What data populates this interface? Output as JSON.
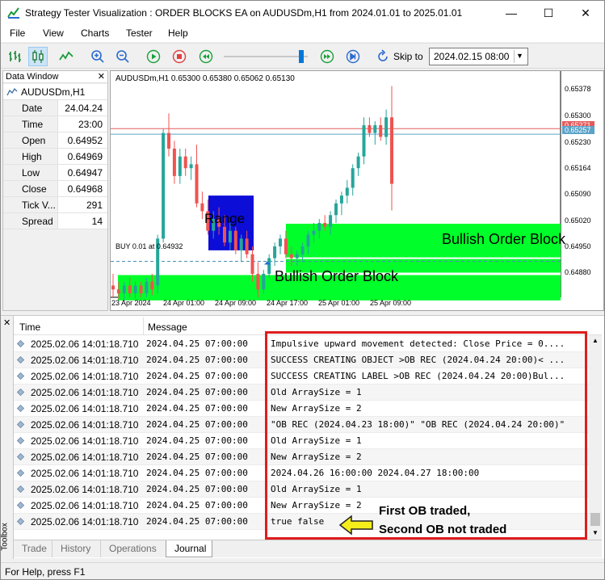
{
  "window": {
    "title": "Strategy Tester Visualization : ORDER BLOCKS EA on AUDUSDm,H1 from 2024.01.01 to 2025.01.01",
    "minimize": "—",
    "maximize": "☐",
    "close": "✕"
  },
  "menu": [
    "File",
    "View",
    "Charts",
    "Tester",
    "Help"
  ],
  "toolbar": {
    "skip_to_label": "Skip to",
    "skip_to_value": "2024.02.15 08:00",
    "slider_position_pct": 90
  },
  "data_window": {
    "title": "Data Window",
    "close": "✕",
    "symbol": "AUDUSDm,H1",
    "rows": [
      {
        "label": "Date",
        "value": "24.04.24"
      },
      {
        "label": "Time",
        "value": "23:00"
      },
      {
        "label": "Open",
        "value": "0.64952"
      },
      {
        "label": "High",
        "value": "0.64969"
      },
      {
        "label": "Low",
        "value": "0.64947"
      },
      {
        "label": "Close",
        "value": "0.64968"
      },
      {
        "label": "Tick V...",
        "value": "291"
      },
      {
        "label": "Spread",
        "value": "14"
      }
    ]
  },
  "chart": {
    "info": "AUDUSDm,H1  0.65300 0.65380 0.65062 0.65130",
    "buy_label": "BUY 0.01 at 0.64932",
    "range_label": "Range",
    "ob_label_1": "Bullish Order Block",
    "ob_label_2": "Bullish Order Block",
    "y_ticks": [
      "0.65378",
      "0.65300",
      "0.65230",
      "0.65164",
      "0.65090",
      "0.65020",
      "0.64950",
      "0.64880"
    ],
    "x_ticks": [
      "23 Apr 2024",
      "24 Apr 01:00",
      "24 Apr 09:00",
      "24 Apr 17:00",
      "25 Apr 01:00",
      "25 Apr 09:00"
    ],
    "price_tags": [
      {
        "value": "0.65271",
        "color": "#e35b5b"
      },
      {
        "value": "0.65257",
        "color": "#5ba3c7"
      }
    ],
    "colors": {
      "bull": "#26a69a",
      "bear": "#ef5350",
      "order_block": "#00ff2a",
      "range": "#0d0dd8"
    }
  },
  "chart_data": {
    "type": "candlestick",
    "symbol": "AUDUSDm",
    "timeframe": "H1",
    "ylim": [
      0.6484,
      0.6541
    ],
    "candles": [
      {
        "o": 0.6487,
        "h": 0.649,
        "l": 0.6484,
        "c": 0.6486
      },
      {
        "o": 0.6486,
        "h": 0.6488,
        "l": 0.64835,
        "c": 0.6485
      },
      {
        "o": 0.6485,
        "h": 0.6488,
        "l": 0.6483,
        "c": 0.6487
      },
      {
        "o": 0.6487,
        "h": 0.6489,
        "l": 0.6484,
        "c": 0.6485
      },
      {
        "o": 0.6485,
        "h": 0.6488,
        "l": 0.64835,
        "c": 0.6487
      },
      {
        "o": 0.6487,
        "h": 0.6488,
        "l": 0.6484,
        "c": 0.6485
      },
      {
        "o": 0.6485,
        "h": 0.6489,
        "l": 0.6484,
        "c": 0.6488
      },
      {
        "o": 0.6488,
        "h": 0.649,
        "l": 0.64845,
        "c": 0.6486
      },
      {
        "o": 0.6487,
        "h": 0.65,
        "l": 0.6485,
        "c": 0.6499
      },
      {
        "o": 0.6499,
        "h": 0.6527,
        "l": 0.6498,
        "c": 0.6526
      },
      {
        "o": 0.6526,
        "h": 0.6531,
        "l": 0.652,
        "c": 0.6522
      },
      {
        "o": 0.6522,
        "h": 0.6524,
        "l": 0.6513,
        "c": 0.6515
      },
      {
        "o": 0.6515,
        "h": 0.6522,
        "l": 0.6513,
        "c": 0.652
      },
      {
        "o": 0.652,
        "h": 0.6522,
        "l": 0.6515,
        "c": 0.6517
      },
      {
        "o": 0.6517,
        "h": 0.652,
        "l": 0.6514,
        "c": 0.6518
      },
      {
        "o": 0.6518,
        "h": 0.6523,
        "l": 0.6507,
        "c": 0.6508
      },
      {
        "o": 0.6508,
        "h": 0.6511,
        "l": 0.6504,
        "c": 0.6506
      },
      {
        "o": 0.6506,
        "h": 0.6509,
        "l": 0.65,
        "c": 0.6501
      },
      {
        "o": 0.6501,
        "h": 0.6506,
        "l": 0.6499,
        "c": 0.6504
      },
      {
        "o": 0.6504,
        "h": 0.6507,
        "l": 0.65,
        "c": 0.6502
      },
      {
        "o": 0.6502,
        "h": 0.6505,
        "l": 0.6497,
        "c": 0.6498
      },
      {
        "o": 0.6498,
        "h": 0.6503,
        "l": 0.6496,
        "c": 0.6501
      },
      {
        "o": 0.6501,
        "h": 0.6502,
        "l": 0.6495,
        "c": 0.6496
      },
      {
        "o": 0.6496,
        "h": 0.65,
        "l": 0.6493,
        "c": 0.6499
      },
      {
        "o": 0.6499,
        "h": 0.6501,
        "l": 0.6494,
        "c": 0.6495
      },
      {
        "o": 0.6495,
        "h": 0.6497,
        "l": 0.6488,
        "c": 0.649
      },
      {
        "o": 0.649,
        "h": 0.6493,
        "l": 0.6484,
        "c": 0.6486
      },
      {
        "o": 0.6486,
        "h": 0.6491,
        "l": 0.6485,
        "c": 0.649
      },
      {
        "o": 0.649,
        "h": 0.6495,
        "l": 0.6489,
        "c": 0.6494
      },
      {
        "o": 0.6494,
        "h": 0.6498,
        "l": 0.6492,
        "c": 0.6497
      },
      {
        "o": 0.6497,
        "h": 0.65,
        "l": 0.6495,
        "c": 0.6499
      },
      {
        "o": 0.6499,
        "h": 0.6501,
        "l": 0.6494,
        "c": 0.6495
      },
      {
        "o": 0.6495,
        "h": 0.6497,
        "l": 0.6492,
        "c": 0.6494
      },
      {
        "o": 0.6494,
        "h": 0.6496,
        "l": 0.6492,
        "c": 0.6495
      },
      {
        "o": 0.6495,
        "h": 0.6498,
        "l": 0.6493,
        "c": 0.6497
      },
      {
        "o": 0.6497,
        "h": 0.6501,
        "l": 0.6495,
        "c": 0.65
      },
      {
        "o": 0.65,
        "h": 0.6503,
        "l": 0.6498,
        "c": 0.6501
      },
      {
        "o": 0.6501,
        "h": 0.6504,
        "l": 0.6499,
        "c": 0.6503
      },
      {
        "o": 0.6503,
        "h": 0.6505,
        "l": 0.6501,
        "c": 0.6502
      },
      {
        "o": 0.6502,
        "h": 0.6506,
        "l": 0.65,
        "c": 0.6505
      },
      {
        "o": 0.6505,
        "h": 0.6509,
        "l": 0.6503,
        "c": 0.6508
      },
      {
        "o": 0.6508,
        "h": 0.6511,
        "l": 0.6505,
        "c": 0.651
      },
      {
        "o": 0.651,
        "h": 0.6514,
        "l": 0.6508,
        "c": 0.6512
      },
      {
        "o": 0.6512,
        "h": 0.6518,
        "l": 0.651,
        "c": 0.6517
      },
      {
        "o": 0.6517,
        "h": 0.6521,
        "l": 0.6515,
        "c": 0.652
      },
      {
        "o": 0.652,
        "h": 0.653,
        "l": 0.6518,
        "c": 0.6528
      },
      {
        "o": 0.6528,
        "h": 0.653,
        "l": 0.6525,
        "c": 0.6526
      },
      {
        "o": 0.6526,
        "h": 0.6529,
        "l": 0.6523,
        "c": 0.6528
      },
      {
        "o": 0.6528,
        "h": 0.653,
        "l": 0.6524,
        "c": 0.6525
      },
      {
        "o": 0.6525,
        "h": 0.6532,
        "l": 0.6523,
        "c": 0.653
      },
      {
        "o": 0.653,
        "h": 0.6538,
        "l": 0.65062,
        "c": 0.6513
      }
    ]
  },
  "journal": {
    "columns": {
      "time": "Time",
      "message": "Message"
    },
    "rows": [
      {
        "time": "2025.02.06 14:01:18.710",
        "date": "2024.04.25 07:00:00",
        "msg": "Impulsive upward movement detected: Close Price = 0...."
      },
      {
        "time": "2025.02.06 14:01:18.710",
        "date": "2024.04.25 07:00:00",
        "msg": "SUCCESS CREATING OBJECT >OB REC (2024.04.24 20:00)< ..."
      },
      {
        "time": "2025.02.06 14:01:18.710",
        "date": "2024.04.25 07:00:00",
        "msg": "SUCCESS CREATING LABEL >OB REC (2024.04.24 20:00)Bul..."
      },
      {
        "time": "2025.02.06 14:01:18.710",
        "date": "2024.04.25 07:00:00",
        "msg": "Old ArraySize = 1"
      },
      {
        "time": "2025.02.06 14:01:18.710",
        "date": "2024.04.25 07:00:00",
        "msg": "New ArraySize = 2"
      },
      {
        "time": "2025.02.06 14:01:18.710",
        "date": "2024.04.25 07:00:00",
        "msg": "\"OB REC (2024.04.23 18:00)\" \"OB REC (2024.04.24 20:00)\""
      },
      {
        "time": "2025.02.06 14:01:18.710",
        "date": "2024.04.25 07:00:00",
        "msg": "Old ArraySize = 1"
      },
      {
        "time": "2025.02.06 14:01:18.710",
        "date": "2024.04.25 07:00:00",
        "msg": "New ArraySize = 2"
      },
      {
        "time": "2025.02.06 14:01:18.710",
        "date": "2024.04.25 07:00:00",
        "msg": "2024.04.26 16:00:00 2024.04.27 18:00:00"
      },
      {
        "time": "2025.02.06 14:01:18.710",
        "date": "2024.04.25 07:00:00",
        "msg": "Old ArraySize = 1"
      },
      {
        "time": "2025.02.06 14:01:18.710",
        "date": "2024.04.25 07:00:00",
        "msg": "New ArraySize = 2"
      },
      {
        "time": "2025.02.06 14:01:18.710",
        "date": "2024.04.25 07:00:00",
        "msg": " true false"
      }
    ],
    "annotation_line1": "First OB traded,",
    "annotation_line2": "Second OB not traded"
  },
  "tabs": [
    "Trade",
    "History",
    "Operations",
    "Journal"
  ],
  "toolbox_label": "Toolbox",
  "status": "For Help, press F1"
}
